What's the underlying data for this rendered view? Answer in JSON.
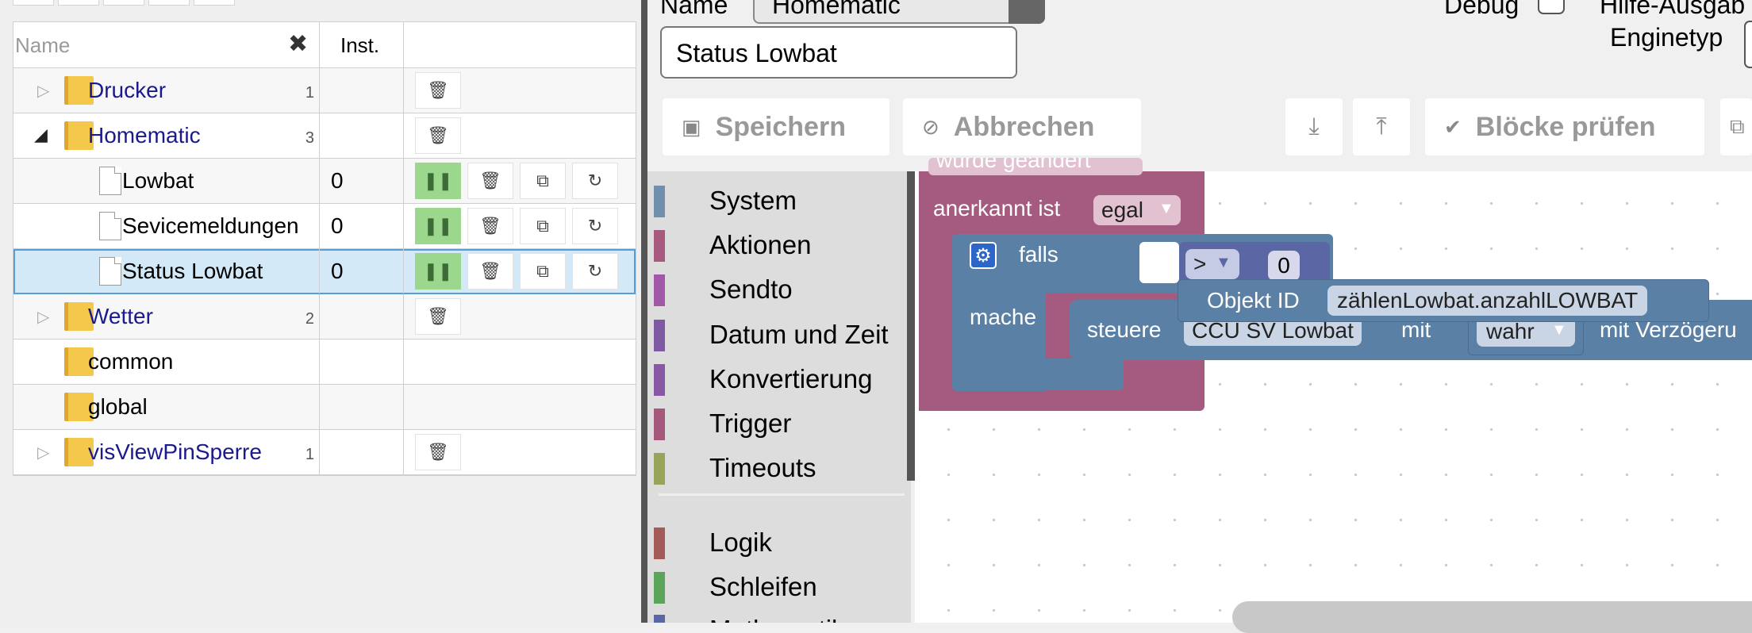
{
  "tree": {
    "header": {
      "name_placeholder": "Name",
      "clear_glyph": "✖",
      "inst_label": "Inst."
    },
    "rows": [
      {
        "label": "Drucker",
        "count": "1"
      },
      {
        "label": "Homematic",
        "count": "3"
      },
      {
        "label": "Lowbat",
        "inst": "0"
      },
      {
        "label": "Sevicemeldungen",
        "inst": "0"
      },
      {
        "label": "Status Lowbat",
        "inst": "0"
      },
      {
        "label": "Wetter",
        "count": "2"
      },
      {
        "label": "common"
      },
      {
        "label": "global"
      },
      {
        "label": "visViewPinSperre",
        "count": "1"
      }
    ]
  },
  "editor": {
    "name_label": "Name",
    "name_value": "Homematic",
    "script_name": "Status Lowbat",
    "debug_label": "Debug",
    "help_label": "Hilfe-Ausgab",
    "engine_label": "Enginetyp"
  },
  "toolbar": {
    "save": "Speichern",
    "cancel": "Abbrechen",
    "check": "Blöcke prüfen"
  },
  "toolbox": {
    "categories": [
      {
        "label": "System",
        "color": "#6f8fad"
      },
      {
        "label": "Aktionen",
        "color": "#a85a7e"
      },
      {
        "label": "Sendto",
        "color": "#a357a8"
      },
      {
        "label": "Datum und Zeit",
        "color": "#7d5aa3"
      },
      {
        "label": "Konvertierung",
        "color": "#8857a6"
      },
      {
        "label": "Trigger",
        "color": "#a5587c"
      },
      {
        "label": "Timeouts",
        "color": "#9aa35a"
      },
      {
        "label": "Logik",
        "color": "#a55a5a"
      },
      {
        "label": "Schleifen",
        "color": "#5ba55b"
      },
      {
        "label": "Mathematik",
        "color": "#5b67a5"
      }
    ]
  },
  "blocks": {
    "cut_top": "wurde geändert",
    "ack_label": "anerkannt ist",
    "ack_value": "egal",
    "if_label": "falls",
    "op": ">",
    "number": "0",
    "do_label": "mache",
    "control_label": "steuere",
    "control_target": "CCU SV Lowbat",
    "with_label": "mit",
    "bool_value": "wahr",
    "delay_label": "mit Verzögeru",
    "object_label": "Objekt ID",
    "object_value": "zählenLowbat.anzahlLOWBAT",
    "colors": {
      "trigger": "#a55b80",
      "logic": "#5b80a5",
      "action": "#5b80a5"
    }
  }
}
